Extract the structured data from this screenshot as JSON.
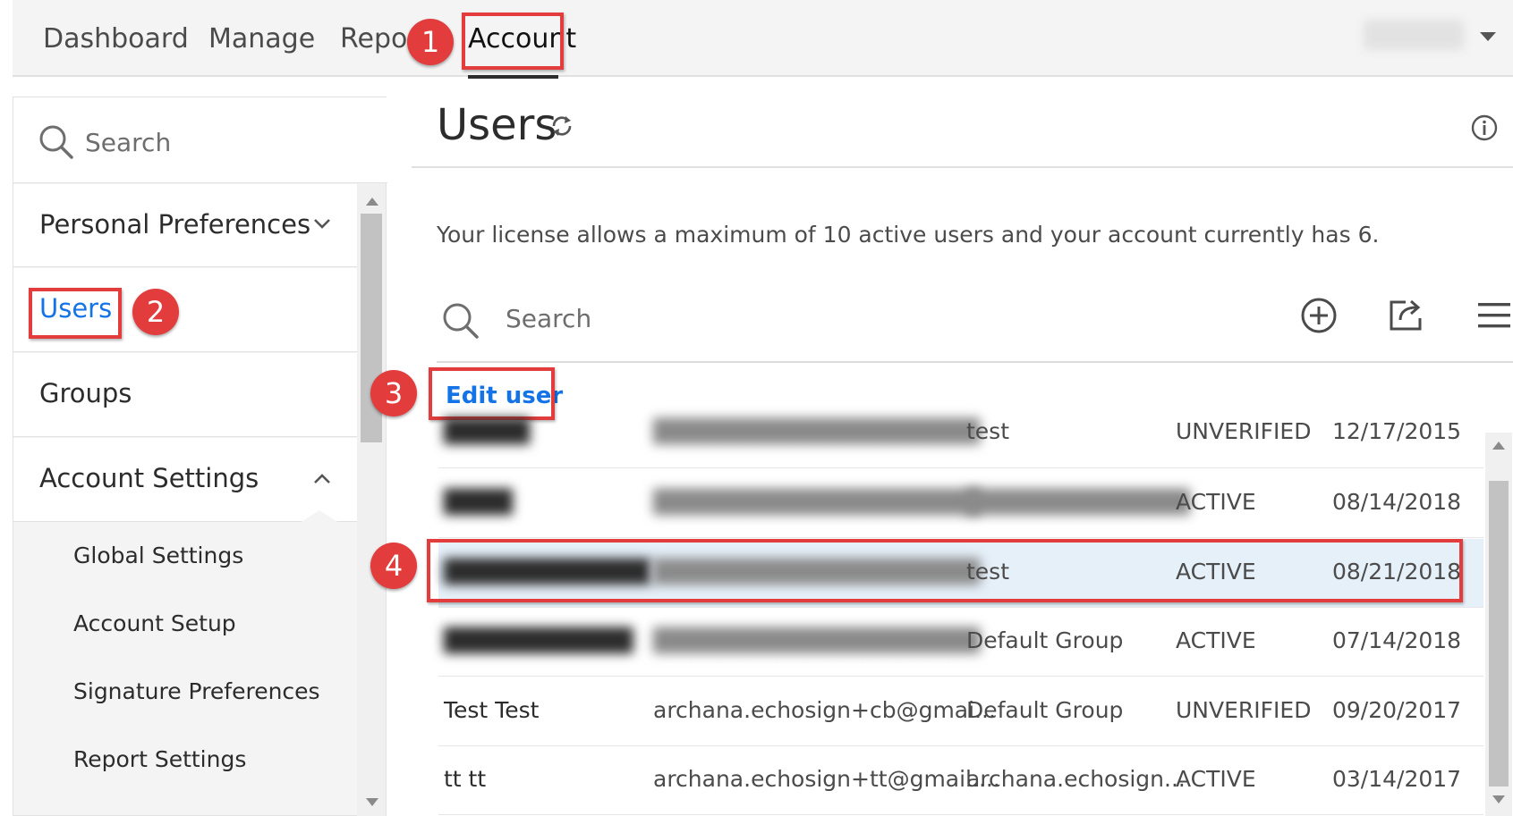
{
  "nav": {
    "items": [
      "Dashboard",
      "Manage",
      "Repor",
      "Account"
    ],
    "active": "Account"
  },
  "sidebar": {
    "search_placeholder": "Search",
    "personal_preferences": "Personal Preferences",
    "users": "Users",
    "groups": "Groups",
    "account_settings": "Account Settings",
    "sub_items": [
      "Global Settings",
      "Account Setup",
      "Signature Preferences",
      "Report Settings"
    ]
  },
  "main": {
    "title": "Users",
    "license_text": "Your license allows a maximum of 10 active users and your account currently has 6.",
    "search_placeholder": "Search",
    "edit_user": "Edit user"
  },
  "table": {
    "rows": [
      {
        "name": "█████",
        "email": "███████████████████",
        "group": "test",
        "status": "UNVERIFIED",
        "date": "12/17/2015",
        "blur_name": true,
        "blur_email": true,
        "blur_group": false
      },
      {
        "name": "████",
        "email": "███████████████████",
        "group": "█████████████",
        "status": "ACTIVE",
        "date": "08/14/2018",
        "blur_name": true,
        "blur_email": true,
        "blur_group": true
      },
      {
        "name": "████████████",
        "email": "███████████████████",
        "group": "test",
        "status": "ACTIVE",
        "date": "08/21/2018",
        "blur_name": true,
        "blur_email": true,
        "blur_group": false,
        "selected": true
      },
      {
        "name": "███████████",
        "email": "███████████████████",
        "group": "Default Group",
        "status": "ACTIVE",
        "date": "07/14/2018",
        "blur_name": true,
        "blur_email": true,
        "blur_group": false
      },
      {
        "name": "Test Test",
        "email": "archana.echosign+cb@gmai...",
        "group": "Default Group",
        "status": "UNVERIFIED",
        "date": "09/20/2017"
      },
      {
        "name": "tt tt",
        "email": "archana.echosign+tt@gmail....",
        "group": "archana.echosign...",
        "status": "ACTIVE",
        "date": "03/14/2017"
      }
    ]
  },
  "callouts": [
    "1",
    "2",
    "3",
    "4"
  ],
  "colors": {
    "accent_blue": "#1473e6",
    "annotation_red": "#e23c3c",
    "selected_row": "#e6f0f9"
  },
  "icons": [
    "search-icon",
    "chevron-down-icon",
    "chevron-up-icon",
    "refresh-icon",
    "info-icon",
    "add-circle-icon",
    "export-icon",
    "hamburger-menu-icon",
    "caret-down-icon"
  ]
}
